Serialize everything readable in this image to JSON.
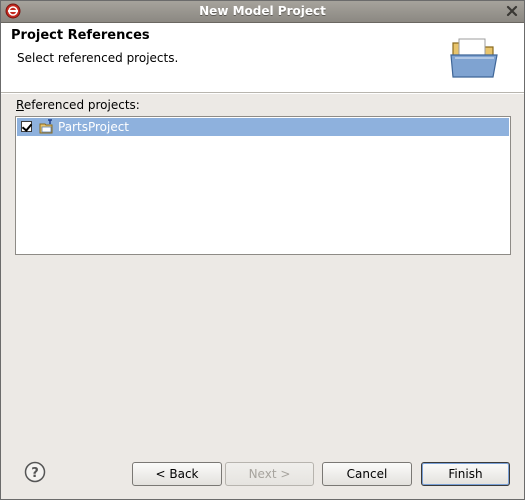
{
  "window": {
    "title": "New Model Project"
  },
  "header": {
    "title": "Project References",
    "description": "Select referenced projects."
  },
  "content": {
    "label_prefix": "R",
    "label_rest": "eferenced projects:",
    "projects": [
      {
        "name": "PartsProject",
        "checked": true
      }
    ]
  },
  "buttons": {
    "back": "< Back",
    "next": "Next >",
    "cancel": "Cancel",
    "finish": "Finish"
  },
  "icons": {
    "app": "eclipse-icon",
    "close": "close-icon",
    "banner": "folder-icon",
    "project": "model-project-icon",
    "help": "help-icon"
  }
}
